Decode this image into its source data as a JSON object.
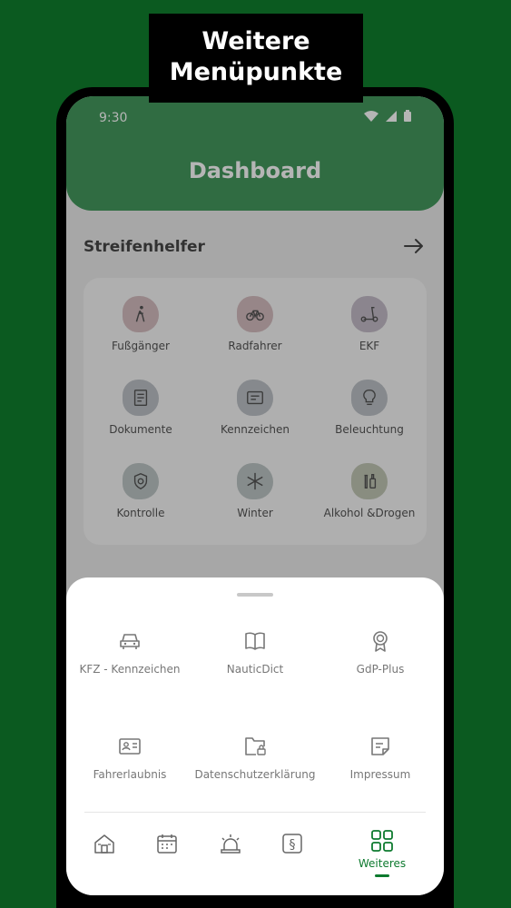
{
  "promo": {
    "line1": "Weitere",
    "line2": "Menüpunkte"
  },
  "status": {
    "time": "9:30"
  },
  "header": {
    "title": "Dashboard"
  },
  "section": {
    "title": "Streifenhelfer"
  },
  "tiles": [
    {
      "label": "Fußgänger",
      "icon": "pedestrian-icon",
      "color": "#c9a9ad"
    },
    {
      "label": "Radfahrer",
      "icon": "bicycle-icon",
      "color": "#c9a9ad"
    },
    {
      "label": "EKF",
      "icon": "scooter-icon",
      "color": "#b3a8b8"
    },
    {
      "label": "Dokumente",
      "icon": "document-icon",
      "color": "#a9b0b6"
    },
    {
      "label": "Kennzeichen",
      "icon": "license-plate-icon",
      "color": "#a9b0b6"
    },
    {
      "label": "Beleuchtung",
      "icon": "lightbulb-icon",
      "color": "#a9b0b6"
    },
    {
      "label": "Kontrolle",
      "icon": "shield-check-icon",
      "color": "#a9b5b4"
    },
    {
      "label": "Winter",
      "icon": "snowflake-icon",
      "color": "#a9b5b4"
    },
    {
      "label": "Alkohol &Drogen",
      "icon": "bottles-icon",
      "color": "#afb69f"
    }
  ],
  "menu": [
    {
      "label": "KFZ - Kennzeichen",
      "icon": "car-icon"
    },
    {
      "label": "NauticDict",
      "icon": "book-icon"
    },
    {
      "label": "GdP-Plus",
      "icon": "badge-icon"
    },
    {
      "label": "Fahrerlaubnis",
      "icon": "id-card-icon"
    },
    {
      "label": "Datenschutzerklärung",
      "icon": "folder-lock-icon"
    },
    {
      "label": "Impressum",
      "icon": "note-icon"
    }
  ],
  "nav": {
    "items": [
      "home-icon",
      "calendar-icon",
      "siren-icon",
      "paragraph-icon"
    ],
    "active": {
      "label": "Weiteres",
      "icon": "grid-icon"
    }
  },
  "colors": {
    "brand": "#0d7a2e",
    "background": "#0b5a20"
  }
}
